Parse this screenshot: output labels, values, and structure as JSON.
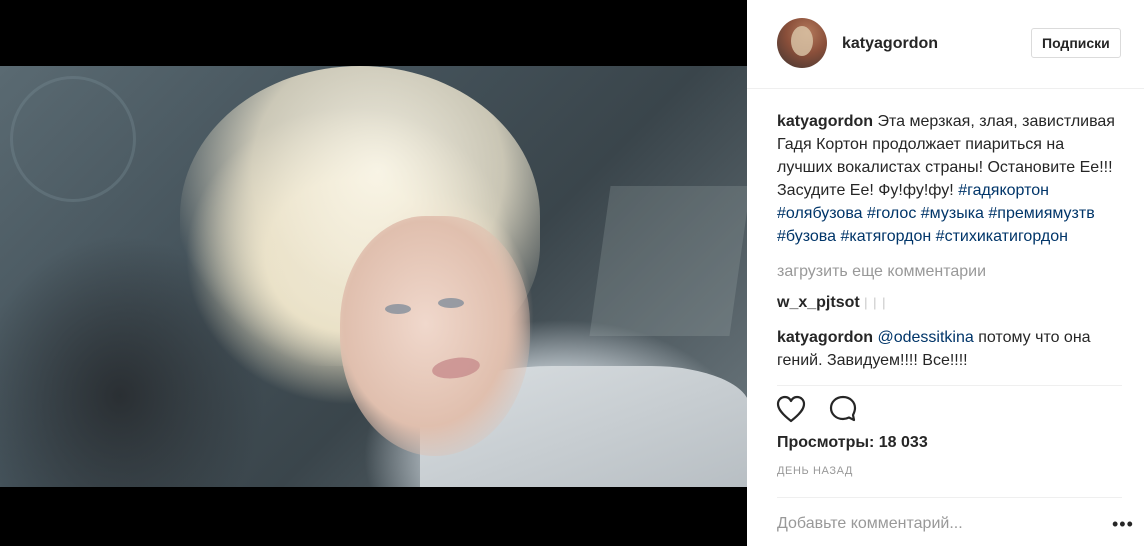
{
  "post": {
    "username": "katyagordon",
    "follow_label": "Подписки"
  },
  "caption": {
    "author": "katyagordon",
    "text": "Эта мерзкая, злая, завистливая Гадя Кортон продолжает пиариться на лучших вокалистах страны! Остановите Ее!!! Засудите Ее! Фу!фу!фу!",
    "hashtags": [
      "#гадякортон",
      "#олябузова",
      "#голос",
      "#музыка",
      "#премиямузтв",
      "#бузова",
      "#катягордон",
      "#стихикатигордон"
    ]
  },
  "load_more_label": "загрузить еще комментарии",
  "comments": [
    {
      "author": "w_x_pjtsot",
      "text": "| | |"
    },
    {
      "author": "katyagordon",
      "mention": "@odessitkina",
      "text": "потому что она гений. Завидуем!!!! Все!!!!"
    }
  ],
  "stats": {
    "views_label": "Просмотры: 18 033",
    "time_label": "день назад"
  },
  "add_comment": {
    "placeholder": "Добавьте комментарий..."
  },
  "icons": [
    "heart-icon",
    "comment-icon",
    "more-options-icon"
  ]
}
